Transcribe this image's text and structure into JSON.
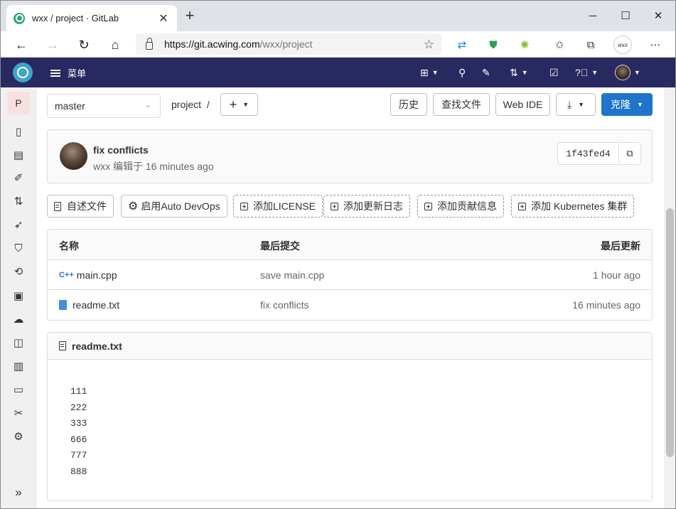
{
  "browser": {
    "tab_title": "wxx / project · GitLab",
    "url_host": "https://git.acwing.com",
    "url_path": "/wxx/project",
    "ext_label": "wxx"
  },
  "header": {
    "menu_label": "菜单"
  },
  "sidebar": {
    "project_initial": "P"
  },
  "toolbar": {
    "branch": "master",
    "breadcrumb_project": "project",
    "breadcrumb_sep": "/",
    "history": "历史",
    "find_file": "查找文件",
    "web_ide": "Web IDE",
    "clone": "克隆"
  },
  "commit": {
    "title": "fix conflicts",
    "meta": "wxx 编辑于 16 minutes ago",
    "sha": "1f43fed4"
  },
  "quick_actions": [
    "自述文件",
    "启用Auto DevOps",
    "添加LICENSE",
    "添加更新日志",
    "添加贡献信息",
    "添加 Kubernetes 集群"
  ],
  "files": {
    "headers": [
      "名称",
      "最后提交",
      "最后更新"
    ],
    "rows": [
      {
        "icon": "cpp-icon",
        "name": "main.cpp",
        "commit": "save main.cpp",
        "updated": "1 hour ago"
      },
      {
        "icon": "text-file-icon",
        "name": "readme.txt",
        "commit": "fix conflicts",
        "updated": "16 minutes ago"
      }
    ]
  },
  "readme": {
    "filename": "readme.txt",
    "lines": [
      "111",
      "222",
      "333",
      "666",
      "777",
      "888"
    ]
  },
  "colors": {
    "header_bg": "#292961",
    "clone_bg": "#1f75cb",
    "logo": "#3ca6c6"
  }
}
